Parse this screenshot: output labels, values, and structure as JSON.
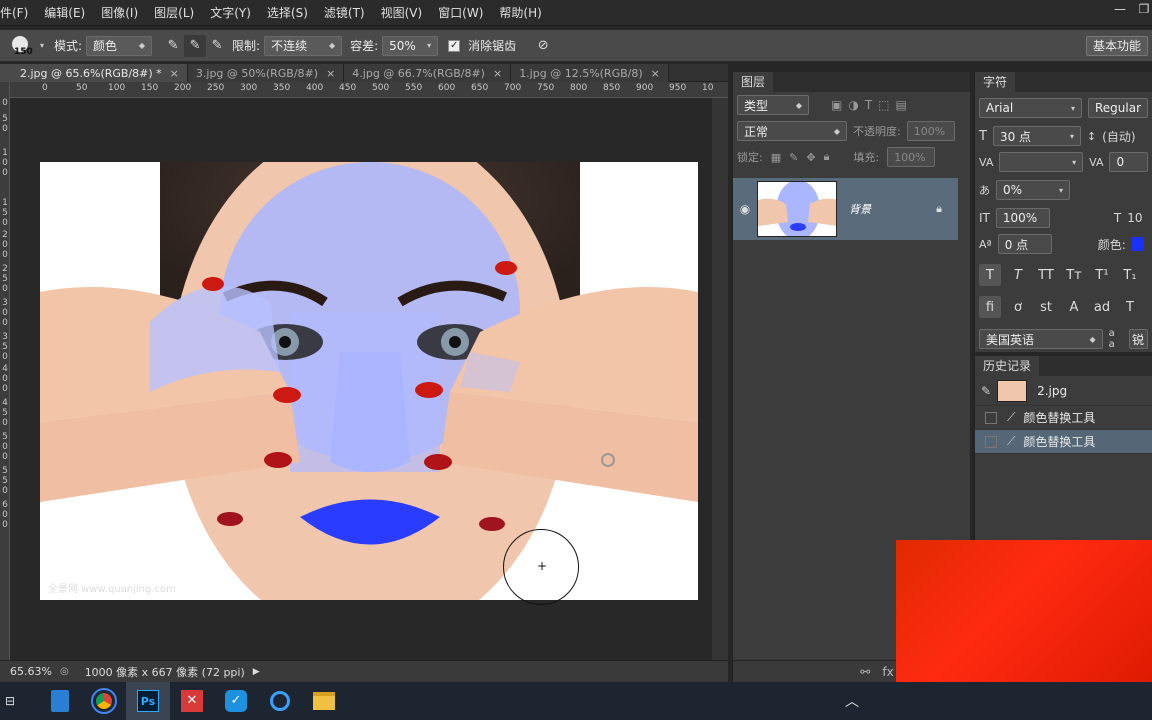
{
  "menubar": {
    "items": [
      "件(F)",
      "编辑(E)",
      "图像(I)",
      "图层(L)",
      "文字(Y)",
      "选择(S)",
      "滤镜(T)",
      "视图(V)",
      "窗口(W)",
      "帮助(H)"
    ],
    "min": "—",
    "restore": "❐"
  },
  "options": {
    "brush_size": "150",
    "mode_label": "模式:",
    "mode_value": "颜色",
    "limit_label": "限制:",
    "limit_value": "不连续",
    "tolerance_label": "容差:",
    "tolerance_value": "50%",
    "antialias_label": "消除锯齿",
    "workspace": "基本功能"
  },
  "tabs": [
    {
      "label": "2.jpg @ 65.6%(RGB/8#) *",
      "close": "×"
    },
    {
      "label": "3.jpg @ 50%(RGB/8#)",
      "close": "×"
    },
    {
      "label": "4.jpg @ 66.7%(RGB/8#)",
      "close": "×"
    },
    {
      "label": "1.jpg @ 12.5%(RGB/8)",
      "close": "×"
    }
  ],
  "ruler_top": [
    "0",
    "50",
    "100",
    "150",
    "200",
    "250",
    "300",
    "350",
    "400",
    "450",
    "500",
    "550",
    "600",
    "650",
    "700",
    "750",
    "800",
    "850",
    "900",
    "950",
    "10"
  ],
  "ruler_left": [
    "0",
    "5",
    "0",
    "1",
    "0",
    "0",
    "1",
    "5",
    "0",
    "2",
    "0",
    "0",
    "2",
    "5",
    "0",
    "3",
    "0",
    "0",
    "3",
    "5",
    "0",
    "4",
    "0",
    "0",
    "4",
    "5",
    "0",
    "5",
    "0",
    "0",
    "5",
    "5",
    "0",
    "6",
    "0",
    "0"
  ],
  "watermark": "全景网 www.quanjing.com",
  "status": {
    "zoom": "65.63%",
    "info": "1000 像素 x 667 像素 (72 ppi)"
  },
  "layers_panel": {
    "tab": "图层",
    "filter": "类型",
    "blend": "正常",
    "opacity_label": "不透明度:",
    "opacity_value": "100%",
    "lock_label": "锁定:",
    "fill_label": "填充:",
    "fill_value": "100%",
    "layer_name": "背景"
  },
  "char_panel": {
    "tab": "字符",
    "font": "Arial",
    "style": "Regular",
    "size": "30 点",
    "leading": "(自动)",
    "kerning": "",
    "tracking": "0",
    "scale_pct": "0%",
    "vscale": "100%",
    "hscale_clip": "10",
    "baseline": "0 点",
    "color_label": "颜色:",
    "language": "美国英语",
    "aa_label": "a a",
    "aa_value": "锐"
  },
  "history_panel": {
    "tab": "历史记录",
    "snapshot": "2.jpg",
    "steps": [
      "颜色替换工具",
      "颜色替换工具"
    ]
  },
  "colors": {
    "accent": "#5a6b7c",
    "tint": "#3a55ff"
  }
}
